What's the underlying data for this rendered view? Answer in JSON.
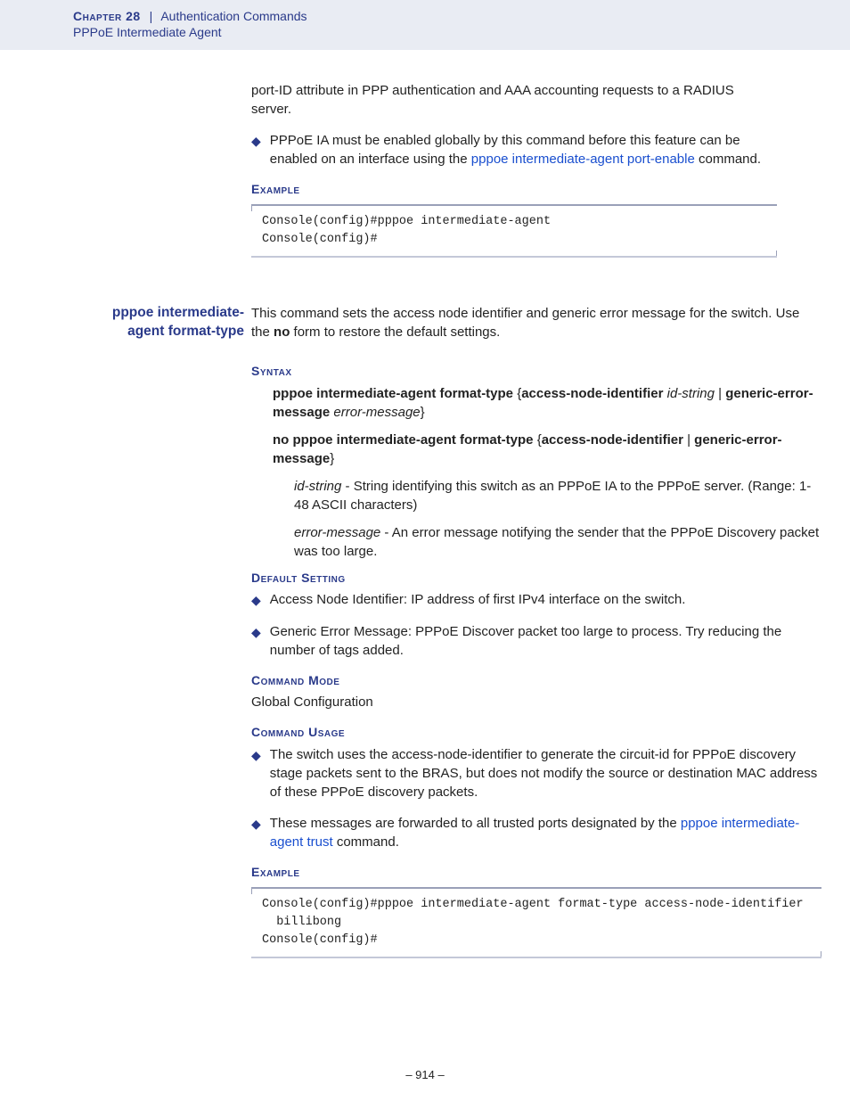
{
  "header": {
    "chapter": "Chapter 28",
    "separator": "|",
    "title": "Authentication Commands",
    "subtitle": "PPPoE Intermediate Agent"
  },
  "intro": {
    "para1": "port-ID attribute in PPP authentication and AAA accounting requests to a RADIUS server.",
    "bullet1_pre": "PPPoE IA must be enabled globally by this command before this feature can be enabled on an interface using the ",
    "bullet1_link": "pppoe intermediate-agent port-enable",
    "bullet1_post": " command."
  },
  "example1": {
    "heading": "Example",
    "code": "Console(config)#pppoe intermediate-agent\nConsole(config)#"
  },
  "cmd": {
    "name_l1": "pppoe intermediate-",
    "name_l2": "agent format-type",
    "desc_pre": "This command sets the access node identifier and generic error message for the switch. Use the ",
    "desc_bold": "no",
    "desc_post": " form to restore the default settings."
  },
  "syntax": {
    "heading": "Syntax",
    "line1": {
      "p1": "pppoe intermediate-agent format-type",
      "brace_open": " {",
      "p2": "access-node-identifier",
      "space": " ",
      "i1": "id-string",
      "sep": " | ",
      "p3": "generic-error-message",
      "i2": "error-message",
      "brace_close": "}"
    },
    "line2": {
      "p1": "no pppoe intermediate-agent format-type",
      "brace_open": " {",
      "p2": "access-node-identifier",
      "sep": " | ",
      "p3": "generic-error-message",
      "brace_close": "}"
    },
    "def1": {
      "term": "id-string",
      "text": " - String identifying this switch as an PPPoE IA to the PPPoE server. (Range: 1-48 ASCII characters)"
    },
    "def2": {
      "term": "error-message",
      "text": " - An error message notifying the sender that the PPPoE Discovery packet was too large."
    }
  },
  "default_setting": {
    "heading": "Default Setting",
    "b1": "Access Node Identifier: IP address of first IPv4 interface on the switch.",
    "b2": "Generic Error Message: PPPoE Discover packet too large to process. Try reducing the number of tags added."
  },
  "command_mode": {
    "heading": "Command Mode",
    "text": "Global Configuration"
  },
  "command_usage": {
    "heading": "Command Usage",
    "b1": "The switch uses the access-node-identifier to generate the circuit-id for PPPoE discovery stage packets sent to the BRAS, but does not modify the source or destination MAC address of these PPPoE discovery packets.",
    "b2_pre": "These messages are forwarded to all trusted ports designated by the ",
    "b2_link": "pppoe intermediate-agent trust",
    "b2_post": " command."
  },
  "example2": {
    "heading": "Example",
    "code": "Console(config)#pppoe intermediate-agent format-type access-node-identifier \n  billibong\nConsole(config)#"
  },
  "footer": "–  914  –"
}
